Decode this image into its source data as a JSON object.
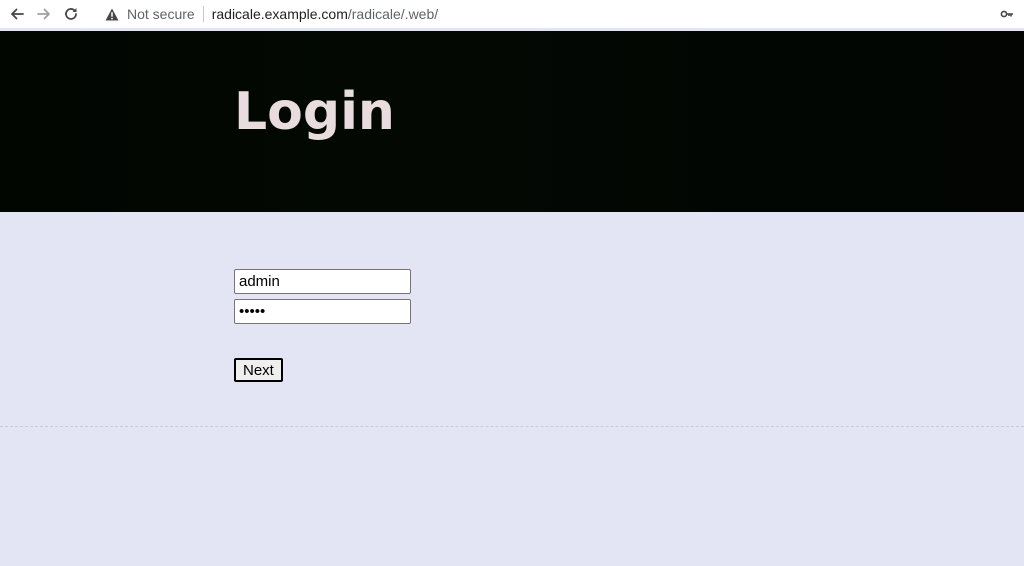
{
  "browser": {
    "security_label": "Not secure",
    "url_host": "radicale.example.com",
    "url_path": "/radicale/.web/",
    "icons": [
      "back-arrow-icon",
      "forward-arrow-icon",
      "reload-icon",
      "warning-icon",
      "key-icon"
    ]
  },
  "header": {
    "title": "Login"
  },
  "form": {
    "username_value": "admin",
    "password_value": "•••••",
    "next_label": "Next"
  },
  "colors": {
    "page_background": "#e3e5f4",
    "header_background": "#020602",
    "title_color": "#e8dcdf"
  }
}
